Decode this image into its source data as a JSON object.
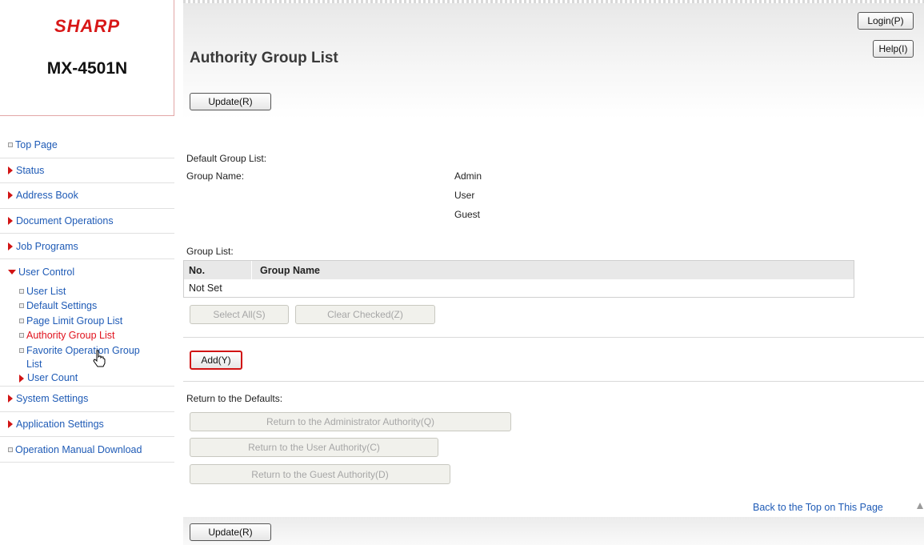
{
  "brand": {
    "logo": "SHARP",
    "model": "MX-4501N"
  },
  "header": {
    "title": "Authority Group List",
    "login_label": "Login(P)",
    "help_label": "Help(I)",
    "update_label": "Update(R)"
  },
  "nav": {
    "top_page": "Top Page",
    "status": "Status",
    "address_book": "Address Book",
    "document_operations": "Document Operations",
    "job_programs": "Job Programs",
    "user_control": "User Control",
    "user_control_items": {
      "user_list": "User List",
      "default_settings": "Default Settings",
      "page_limit": "Page Limit Group List",
      "authority": "Authority Group List",
      "favorite_line1": "Favorite Operation Group",
      "favorite_line2": "List",
      "user_count": "User Count"
    },
    "system_settings": "System Settings",
    "application_settings": "Application Settings",
    "manual_download": "Operation Manual Download"
  },
  "content": {
    "default_group_list_label": "Default Group List:",
    "group_name_label": "Group Name:",
    "default_groups": [
      "Admin",
      "User",
      "Guest"
    ],
    "group_list_label": "Group List:",
    "table": {
      "col_no": "No.",
      "col_group_name": "Group Name",
      "empty_row": "Not Set"
    },
    "select_all_label": "Select All(S)",
    "clear_checked_label": "Clear Checked(Z)",
    "add_label": "Add(Y)",
    "return_defaults_label": "Return to the Defaults:",
    "return_admin_label": "Return to the Administrator Authority(Q)",
    "return_user_label": "Return to the User Authority(C)",
    "return_guest_label": "Return to the Guest Authority(D)",
    "back_to_top": "Back to the Top on This Page"
  },
  "footer": {
    "update_label": "Update(R)"
  },
  "colors": {
    "brand_red": "#d81717",
    "link_blue": "#1f5bb6",
    "active_red": "#e0121d"
  },
  "icons": [
    "square-bullet-icon",
    "red-triangle-icon",
    "hand-pointer-cursor-icon",
    "up-arrow-icon"
  ]
}
